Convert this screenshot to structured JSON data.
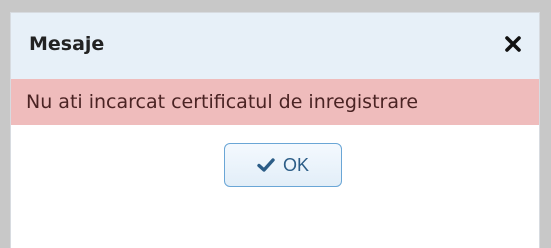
{
  "dialog": {
    "title": "Mesaje",
    "close_icon": "close-icon",
    "message": "Nu ati incarcat certificatul de inregistrare",
    "ok_label": "OK",
    "ok_icon": "checkmark-icon"
  },
  "colors": {
    "titlebar_bg": "#e7f0f8",
    "message_bg": "#efbcbc",
    "button_border": "#6aa6d6",
    "button_text": "#2c5d87"
  }
}
